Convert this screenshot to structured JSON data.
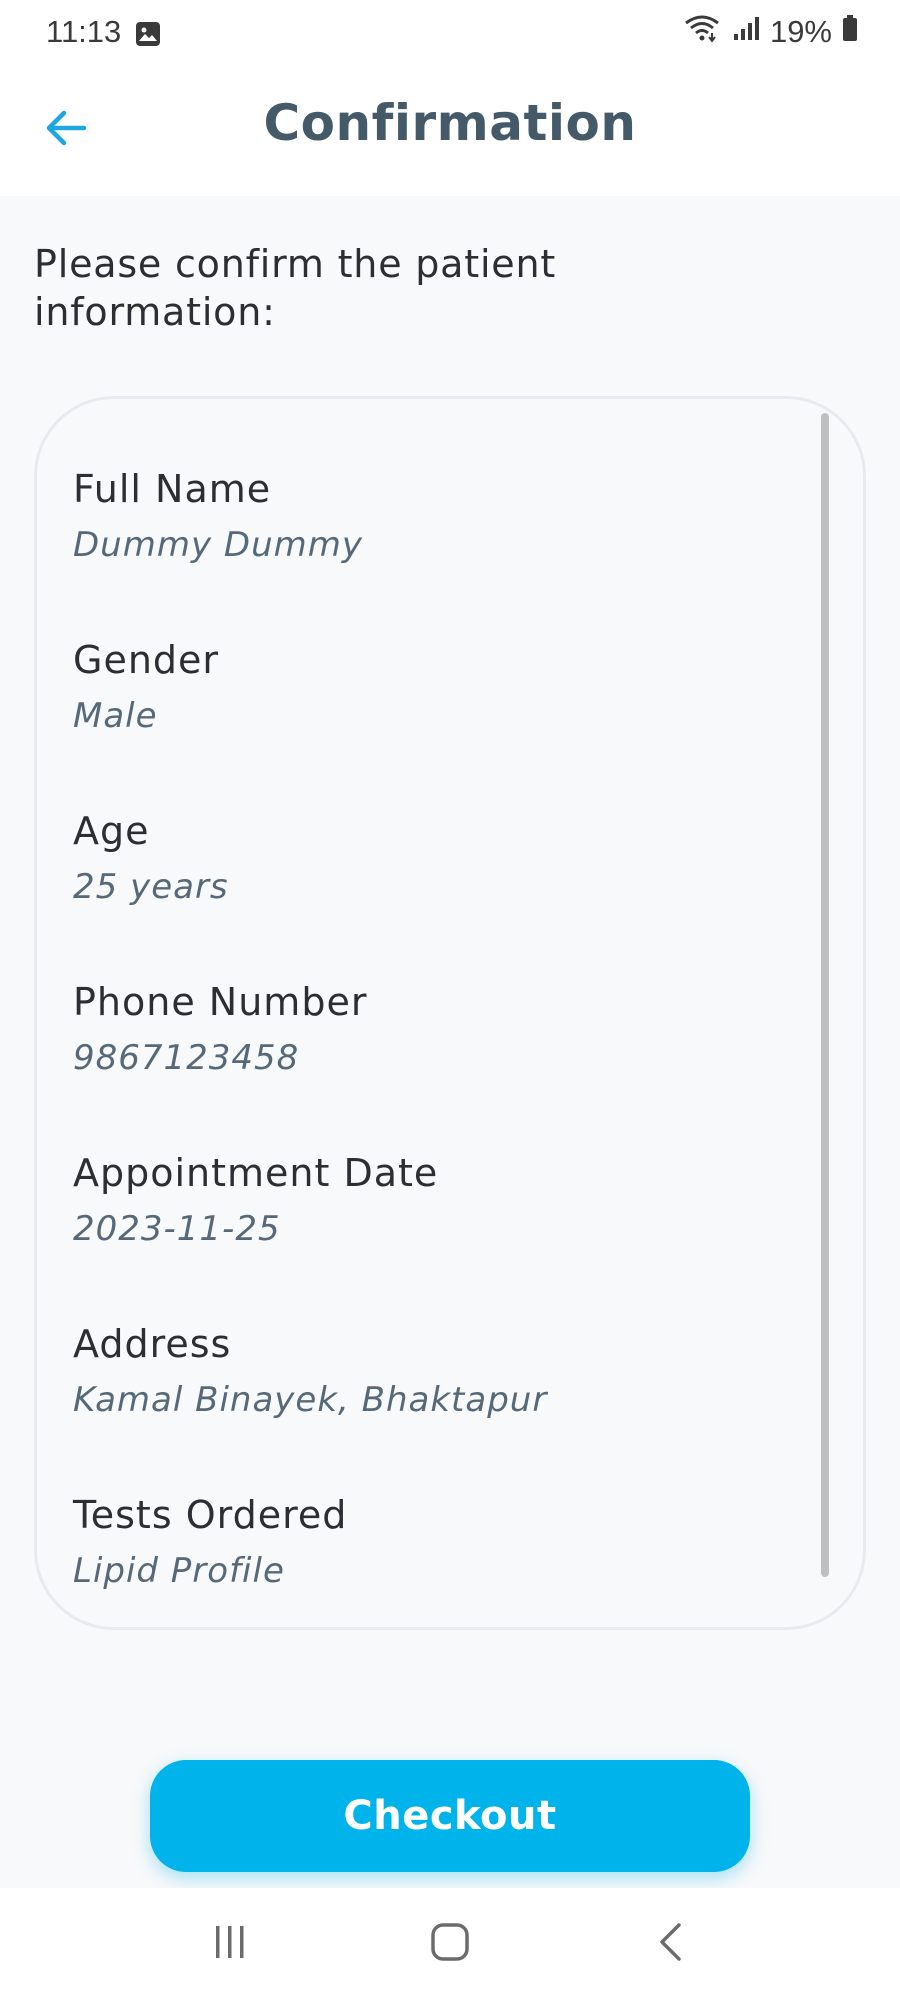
{
  "status_bar": {
    "time": "11:13",
    "battery": "19%",
    "icons": [
      "gallery-notification-icon",
      "wifi-icon",
      "signal-icon",
      "battery-icon"
    ]
  },
  "header": {
    "title": "Confirmation",
    "back_icon": "back-arrow-icon"
  },
  "prompt": "Please confirm the patient information:",
  "patient": {
    "fields": [
      {
        "label": "Full Name",
        "value": "Dummy Dummy"
      },
      {
        "label": "Gender",
        "value": "Male"
      },
      {
        "label": "Age",
        "value": "25 years"
      },
      {
        "label": "Phone Number",
        "value": "9867123458"
      },
      {
        "label": "Appointment Date",
        "value": "2023-11-25"
      },
      {
        "label": "Address",
        "value": "Kamal Binayek, Bhaktapur"
      },
      {
        "label": "Tests Ordered",
        "value": "Lipid Profile"
      }
    ]
  },
  "checkout": {
    "label": "Checkout"
  },
  "nav": {
    "icons": [
      "recent-apps-icon",
      "home-icon",
      "back-nav-icon"
    ]
  },
  "colors": {
    "accent": "#00b3ea",
    "title": "#455a69",
    "value_text": "#56697a",
    "background": "#f8f9fa"
  }
}
